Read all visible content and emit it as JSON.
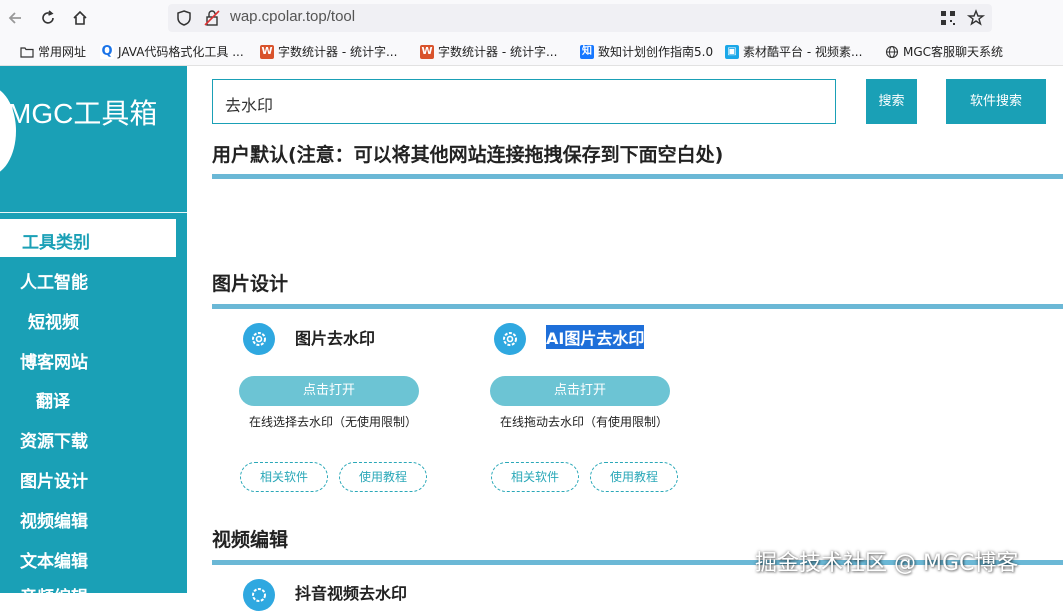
{
  "browser": {
    "url": "wap.cpolar.top/tool",
    "bookmarks": [
      {
        "label": "常用网址",
        "icon": "folder-icon"
      },
      {
        "label": "JAVA代码格式化工具 ...",
        "icon": "q-icon"
      },
      {
        "label": "字数统计器 - 统计字...",
        "icon": "w-icon"
      },
      {
        "label": "字数统计器 - 统计字...",
        "icon": "w-icon"
      },
      {
        "label": "致知计划创作指南5.0",
        "icon": "zhi-icon"
      },
      {
        "label": "素材酷平台 - 视频素...",
        "icon": "tv-icon"
      },
      {
        "label": "MGC客服聊天系统",
        "icon": "globe-icon"
      }
    ]
  },
  "sidebar": {
    "logo": "MGC工具箱",
    "active": "工具类别",
    "items": [
      "人工智能",
      "短视频",
      "博客网站",
      "翻译",
      "资源下载",
      "图片设计",
      "视频编辑",
      "文本编辑",
      "音频编辑"
    ]
  },
  "search": {
    "value": "去水印",
    "search_label": "搜索",
    "software_search_label": "软件搜索"
  },
  "sections": {
    "user_default": "用户默认(注意：可以将其他网站连接拖拽保存到下面空白处)",
    "image_design": "图片设计",
    "video_edit": "视频编辑"
  },
  "cards": [
    {
      "title": "图片去水印",
      "open_label": "点击打开",
      "desc": "在线选择去水印（无使用限制）",
      "related": "相关软件",
      "tutorial": "使用教程"
    },
    {
      "title": "AI图片去水印",
      "open_label": "点击打开",
      "desc": "在线拖动去水印（有使用限制）",
      "related": "相关软件",
      "tutorial": "使用教程"
    },
    {
      "title": "抖音视频去水印"
    }
  ],
  "watermark": "掘金技术社区 @ MGC博客",
  "colors": {
    "accent": "#1aa0b6",
    "open_button": "#6cc4d4",
    "section_line": "#6bb8d6",
    "gear": "#2fa8e0"
  }
}
